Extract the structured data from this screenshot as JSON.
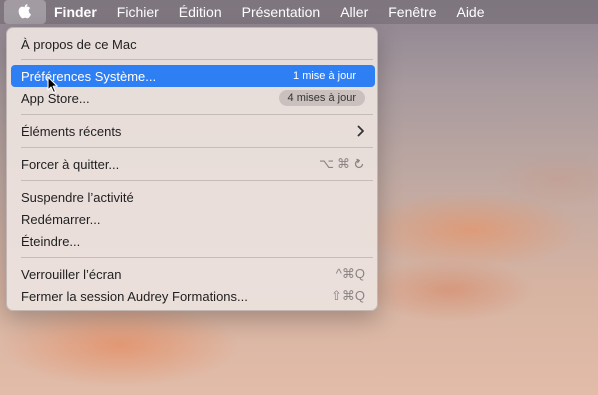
{
  "menubar": {
    "apple_icon": "apple-logo-icon",
    "items": [
      "Finder",
      "Fichier",
      "Édition",
      "Présentation",
      "Aller",
      "Fenêtre",
      "Aide"
    ]
  },
  "apple_menu": {
    "about": "À propos de ce Mac",
    "system_prefs": {
      "label": "Préférences Système...",
      "badge": "1 mise à jour"
    },
    "app_store": {
      "label": "App Store...",
      "badge": "4 mises à jour"
    },
    "recent_items": {
      "label": "Éléments récents",
      "icon": "chevron-right-icon"
    },
    "force_quit": {
      "label": "Forcer à quitter...",
      "shortcut": "⌥⌘⎋"
    },
    "sleep": "Suspendre l’activité",
    "restart": "Redémarrer...",
    "shutdown": "Éteindre...",
    "lock_screen": {
      "label": "Verrouiller l’écran",
      "shortcut": "^⌘Q"
    },
    "logout": {
      "label": "Fermer la session Audrey Formations...",
      "shortcut": "⇧⌘Q"
    }
  },
  "colors": {
    "selection": "#2f7ff4",
    "menubar": "#78707a",
    "menu_bg": "#ece2de"
  }
}
